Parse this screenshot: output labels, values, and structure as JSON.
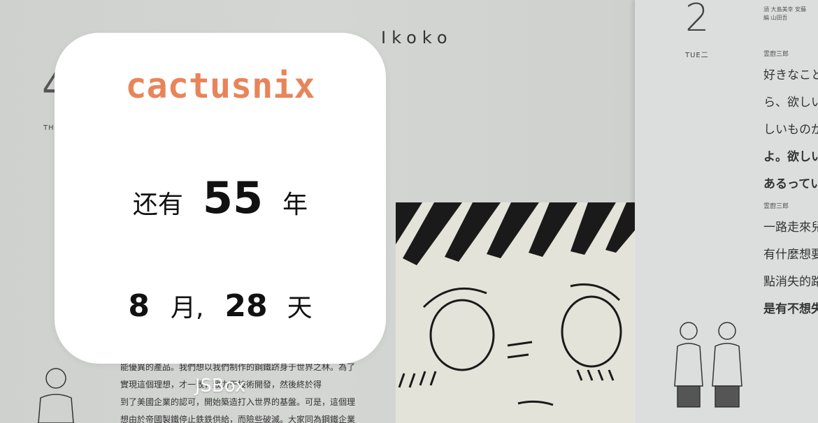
{
  "wallpaper": {
    "header_word": "Ikoko",
    "page_number_right": "2",
    "page_number_left": "4",
    "day_label": "TUE二",
    "left_day_label": "TH",
    "credits": [
      "須 大島美幸 安藤",
      "編 山田吾"
    ],
    "jp_lines": [
      {
        "text": "霊廚三郎",
        "style": "small"
      },
      {
        "text": "好きなこと",
        "style": "normal"
      },
      {
        "text": "ら、欲しい",
        "style": "normal"
      },
      {
        "text": "しいものが",
        "style": "normal"
      },
      {
        "text": "よ。欲しい",
        "style": "bold"
      },
      {
        "text": "あるってい",
        "style": "bold"
      },
      {
        "text": "霊廚三郎",
        "style": "small"
      },
      {
        "text": "一路走來兒",
        "style": "normal"
      },
      {
        "text": "有什麼想要",
        "style": "normal"
      },
      {
        "text": "點消失的路",
        "style": "normal"
      },
      {
        "text": "是有不想失",
        "style": "bold"
      }
    ],
    "zh_lines": [
      "能優異的產品。我們想以我們制作的鋼鐵跻身于世界之林。為了",
      "實現這個理想，才一致，致力于技術開發，然後終於得",
      "到了美國企業的認可，開始築造打入世界的基盤。可是，這個理",
      "想由於帝國製鐵停止鉄鉄供給，而險些破滅。大家同為鋼鐵企業"
    ]
  },
  "widget": {
    "title": "cactusnix",
    "title_color": "#E8845A",
    "years_prefix": "还有",
    "years_value": "55",
    "years_unit": "年",
    "months_value": "8",
    "months_unit": "月",
    "separator": ",",
    "days_value": "28",
    "days_unit": "天"
  },
  "caption": "JSBox"
}
